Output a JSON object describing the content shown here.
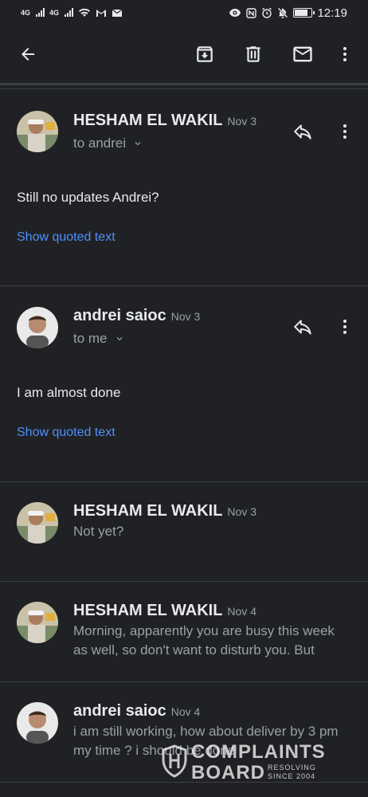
{
  "status_bar": {
    "left": [
      "4G",
      "4G",
      "wifi",
      "gmail",
      "email"
    ],
    "time": "12:19",
    "battery_level": 0.8,
    "net1": "4G",
    "net2": "4G"
  },
  "toolbar": {
    "back": "arrow-back-icon",
    "archive": "archive-icon",
    "delete": "delete-icon",
    "mark_unread": "mail-icon",
    "more": "more-vert-icon"
  },
  "messages": [
    {
      "sender": "HESHAM EL WAKIL",
      "date": "Nov 3",
      "recipient": "to andrei",
      "body": "Still no updates Andrei?",
      "quoted": "Show quoted text"
    },
    {
      "sender": "andrei saioc",
      "date": "Nov 3",
      "recipient": "to me",
      "body": "I am almost done",
      "quoted": "Show quoted text"
    },
    {
      "sender": "HESHAM EL WAKIL",
      "date": "Nov 3",
      "snippet": "Not yet?"
    },
    {
      "sender": "HESHAM EL WAKIL",
      "date": "Nov 4",
      "snippet": "Morning, apparently you are busy this week as well, so don't want to disturb you. But"
    },
    {
      "sender": "andrei saioc",
      "date": "Nov 4",
      "snippet": "i am still working, how about deliver by 3 pm my time ? i should be done"
    }
  ],
  "watermark": {
    "line1": "COMPLAINTS",
    "line2": "BOARD",
    "tag1": "RESOLVING",
    "tag2": "SINCE 2004"
  },
  "colors": {
    "background": "#202124",
    "link": "#4d90fe",
    "secondary_text": "#9aa0a6"
  }
}
